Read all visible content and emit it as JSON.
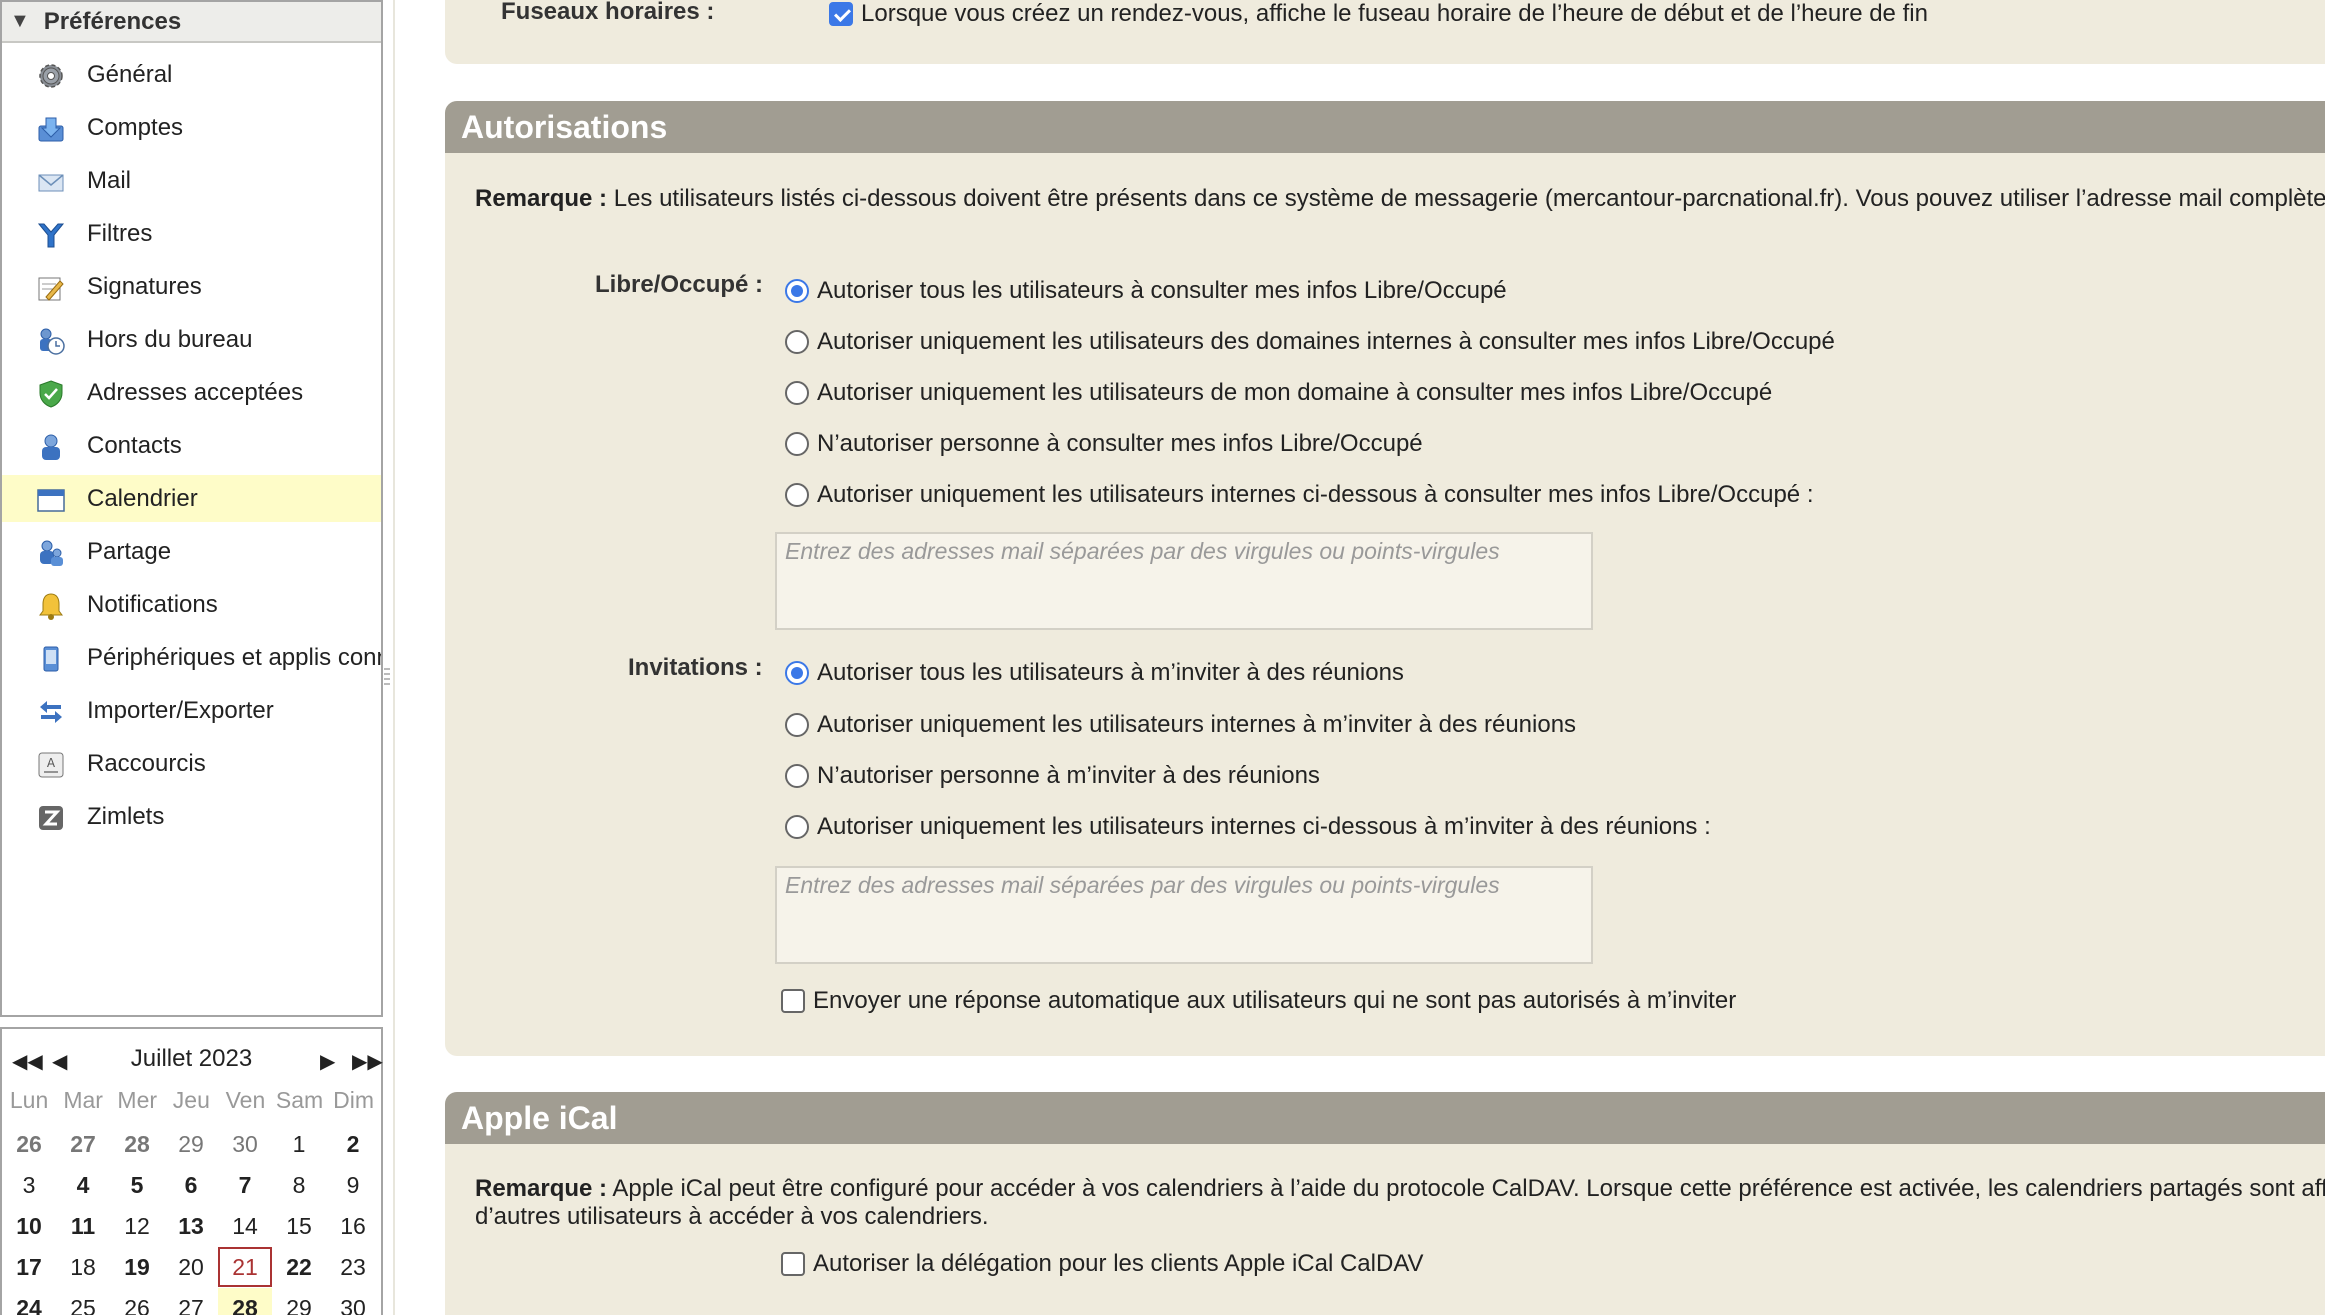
{
  "tree": {
    "title": "Préférences",
    "items": [
      {
        "label": "Général",
        "icon": "gear-icon"
      },
      {
        "label": "Comptes",
        "icon": "accounts-icon"
      },
      {
        "label": "Mail",
        "icon": "mail-icon"
      },
      {
        "label": "Filtres",
        "icon": "filter-icon"
      },
      {
        "label": "Signatures",
        "icon": "signature-icon"
      },
      {
        "label": "Hors du bureau",
        "icon": "out-of-office-icon"
      },
      {
        "label": "Adresses acceptées",
        "icon": "shield-icon"
      },
      {
        "label": "Contacts",
        "icon": "contact-icon"
      },
      {
        "label": "Calendrier",
        "icon": "calendar-icon"
      },
      {
        "label": "Partage",
        "icon": "sharing-icon"
      },
      {
        "label": "Notifications",
        "icon": "bell-icon"
      },
      {
        "label": "Périphériques et applis connectés",
        "icon": "device-icon"
      },
      {
        "label": "Importer/Exporter",
        "icon": "import-export-icon"
      },
      {
        "label": "Raccourcis",
        "icon": "shortcut-icon"
      },
      {
        "label": "Zimlets",
        "icon": "zimlet-icon"
      }
    ],
    "selected": "Calendrier"
  },
  "calendar": {
    "title": "Juillet 2023",
    "days": [
      "Lun",
      "Mar",
      "Mer",
      "Jeu",
      "Ven",
      "Sam",
      "Dim"
    ],
    "weeks": [
      [
        "26",
        "27",
        "28",
        "29",
        "30",
        "1",
        "2"
      ],
      [
        "3",
        "4",
        "5",
        "6",
        "7",
        "8",
        "9"
      ],
      [
        "10",
        "11",
        "12",
        "13",
        "14",
        "15",
        "16"
      ],
      [
        "17",
        "18",
        "19",
        "20",
        "21",
        "22",
        "23"
      ],
      [
        "24",
        "25",
        "26",
        "27",
        "28",
        "29",
        "30"
      ]
    ],
    "today": "21",
    "highlighted": "28"
  },
  "timezone": {
    "label": "Fuseaux horaires :",
    "option": "Lorsque vous créez un rendez-vous, affiche le fuseau horaire de l’heure de début et de l’heure de fin"
  },
  "permissions": {
    "title": "Autorisations",
    "note_label": "Remarque :",
    "note_text": "Les utilisateurs listés ci-dessous doivent être présents dans ce système de messagerie (mercantour-parcnational.fr). Vous pouvez utiliser l’adresse mail complète",
    "freebusy_label": "Libre/Occupé :",
    "freebusy_options": [
      "Autoriser tous les utilisateurs à consulter mes infos Libre/Occupé",
      "Autoriser uniquement les utilisateurs des domaines internes à consulter mes infos Libre/Occupé",
      "Autoriser uniquement les utilisateurs de mon domaine à consulter mes infos Libre/Occupé",
      "N’autoriser personne à consulter mes infos Libre/Occupé",
      "Autoriser uniquement les utilisateurs internes ci-dessous à consulter mes infos Libre/Occupé :"
    ],
    "freebusy_placeholder": "Entrez des adresses mail séparées par des virgules ou points-virgules",
    "invite_label": "Invitations :",
    "invite_options": [
      "Autoriser tous les utilisateurs à m’inviter à des réunions",
      "Autoriser uniquement les utilisateurs internes à m’inviter à des réunions",
      "N’autoriser personne à m’inviter à des réunions",
      "Autoriser uniquement les utilisateurs internes ci-dessous à m’inviter à des réunions :"
    ],
    "invite_placeholder": "Entrez des adresses mail séparées par des virgules ou points-virgules",
    "auto_reply": "Envoyer une réponse automatique aux utilisateurs qui ne sont pas autorisés à m’inviter"
  },
  "ical": {
    "title": "Apple iCal",
    "note_label": "Remarque :",
    "note_line1": "Apple iCal peut être configuré pour accéder à vos calendriers à l’aide du protocole CalDAV. Lorsque cette préférence est activée, les calendriers partagés sont aff",
    "note_line2": "d’autres utilisateurs à accéder à vos calendriers.",
    "delegation": "Autoriser la délégation pour les clients Apple iCal CalDAV"
  },
  "colors": {
    "section_header": "#a19d92",
    "section_body": "#efebdd",
    "selected_item": "#fefcc8",
    "accent": "#3b78e7",
    "today_border": "#aa3333"
  }
}
